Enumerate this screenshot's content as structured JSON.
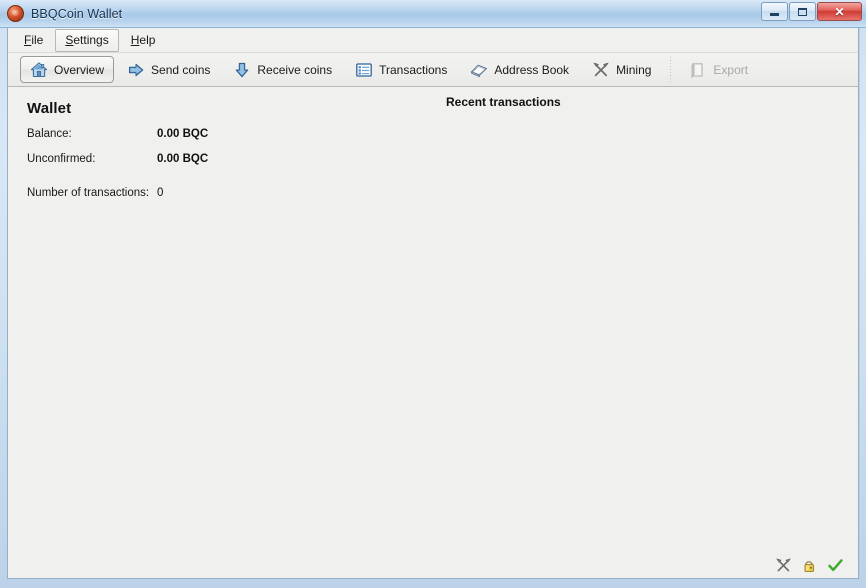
{
  "window": {
    "title": "BBQCoin Wallet",
    "app_icon": "bbqcoin-logo-icon",
    "controls": {
      "minimize": "minimize-icon",
      "minimize_label": "–",
      "maximize": "maximize-icon",
      "maximize_label": "□",
      "close": "close-icon",
      "close_label": "✕"
    },
    "accent_titlebar": "#a8c9e8",
    "frame_border": "#93b0cb",
    "client_bg": "#f0f0ee"
  },
  "menu": {
    "items": [
      {
        "label": "File",
        "mnemonic": "F",
        "active": false
      },
      {
        "label": "Settings",
        "mnemonic": "S",
        "active": true
      },
      {
        "label": "Help",
        "mnemonic": "H",
        "active": false
      }
    ]
  },
  "toolbar": {
    "items": [
      {
        "label": "Overview",
        "icon": "home-icon",
        "selected": true,
        "disabled": false
      },
      {
        "label": "Send coins",
        "icon": "arrow-right-icon",
        "selected": false,
        "disabled": false
      },
      {
        "label": "Receive coins",
        "icon": "arrow-down-icon",
        "selected": false,
        "disabled": false
      },
      {
        "label": "Transactions",
        "icon": "list-icon",
        "selected": false,
        "disabled": false
      },
      {
        "label": "Address Book",
        "icon": "address-book-icon",
        "selected": false,
        "disabled": false
      },
      {
        "label": "Mining",
        "icon": "hammers-icon",
        "selected": false,
        "disabled": false
      }
    ],
    "export": {
      "label": "Export",
      "icon": "clipboard-icon",
      "disabled": true
    }
  },
  "overview": {
    "wallet": {
      "title": "Wallet",
      "rows": [
        {
          "label": "Balance:",
          "value": "0.00 BQC"
        },
        {
          "label": "Unconfirmed:",
          "value": "0.00 BQC"
        }
      ],
      "transactions_count": {
        "label": "Number of transactions:",
        "value": "0"
      }
    },
    "recent": {
      "title": "Recent transactions",
      "entries": []
    }
  },
  "status_bar": {
    "icons": [
      {
        "name": "mining-hammers-icon",
        "title": "Mining"
      },
      {
        "name": "wallet-lock-icon",
        "title": "Wallet"
      },
      {
        "name": "sync-check-icon",
        "title": "Synchronized"
      }
    ]
  }
}
